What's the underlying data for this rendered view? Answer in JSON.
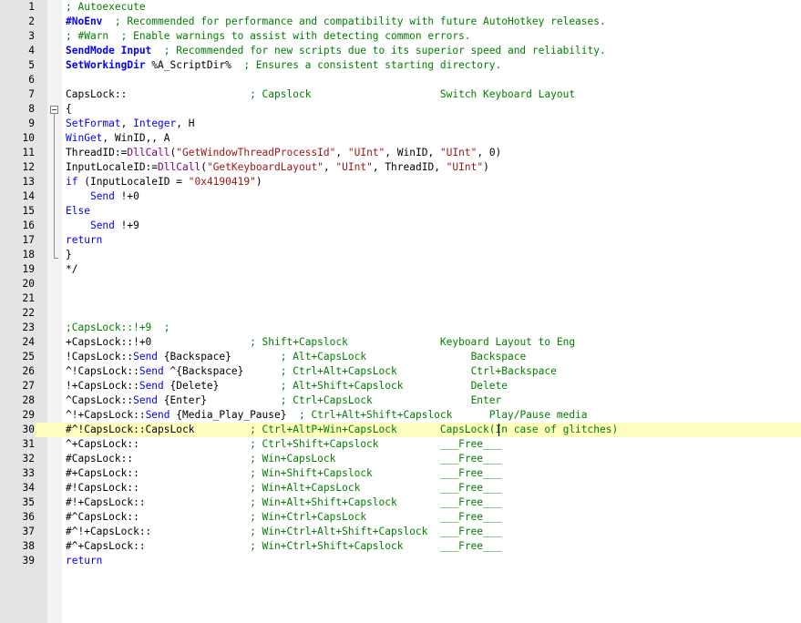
{
  "editor": {
    "current_line": 30,
    "lines": [
      {
        "n": "1",
        "tokens": [
          {
            "t": "; Autoexecute",
            "c": "comment"
          }
        ]
      },
      {
        "n": "2",
        "tokens": [
          {
            "t": "#NoEnv",
            "c": "dir"
          },
          {
            "t": "  ; Recommended for performance and compatibility with future AutoHotkey releases.",
            "c": "comment"
          }
        ]
      },
      {
        "n": "3",
        "tokens": [
          {
            "t": "; #Warn  ; Enable warnings to assist with detecting common errors.",
            "c": "comment"
          }
        ]
      },
      {
        "n": "4",
        "tokens": [
          {
            "t": "SendMode Input",
            "c": "dir"
          },
          {
            "t": "  ; Recommended for new scripts due to its superior speed and reliability.",
            "c": "comment"
          }
        ]
      },
      {
        "n": "5",
        "tokens": [
          {
            "t": "SetWorkingDir",
            "c": "dir"
          },
          {
            "t": " %A_ScriptDir%",
            "c": "plain"
          },
          {
            "t": "  ; Ensures a consistent starting directory.",
            "c": "comment"
          }
        ]
      },
      {
        "n": "6",
        "tokens": []
      },
      {
        "n": "7",
        "tokens": [
          {
            "t": "CapsLock::                    ",
            "c": "plain"
          },
          {
            "t": "; Capslock                     Switch Keyboard Layout",
            "c": "comment"
          }
        ]
      },
      {
        "n": "8",
        "tokens": [
          {
            "t": "{",
            "c": "plain"
          }
        ]
      },
      {
        "n": "9",
        "tokens": [
          {
            "t": "SetFormat",
            "c": "cmd"
          },
          {
            "t": ", ",
            "c": "plain"
          },
          {
            "t": "Integer",
            "c": "cmd"
          },
          {
            "t": ", H",
            "c": "plain"
          }
        ]
      },
      {
        "n": "10",
        "tokens": [
          {
            "t": "WinGet",
            "c": "cmd"
          },
          {
            "t": ", WinID,, A",
            "c": "plain"
          }
        ]
      },
      {
        "n": "11",
        "tokens": [
          {
            "t": "ThreadID:=",
            "c": "plain"
          },
          {
            "t": "DllCall",
            "c": "fn"
          },
          {
            "t": "(",
            "c": "plain"
          },
          {
            "t": "\"GetWindowThreadProcessId\"",
            "c": "str"
          },
          {
            "t": ", ",
            "c": "plain"
          },
          {
            "t": "\"UInt\"",
            "c": "str"
          },
          {
            "t": ", WinID, ",
            "c": "plain"
          },
          {
            "t": "\"UInt\"",
            "c": "str"
          },
          {
            "t": ", 0)",
            "c": "plain"
          }
        ]
      },
      {
        "n": "12",
        "tokens": [
          {
            "t": "InputLocaleID:=",
            "c": "plain"
          },
          {
            "t": "DllCall",
            "c": "fn"
          },
          {
            "t": "(",
            "c": "plain"
          },
          {
            "t": "\"GetKeyboardLayout\"",
            "c": "str"
          },
          {
            "t": ", ",
            "c": "plain"
          },
          {
            "t": "\"UInt\"",
            "c": "str"
          },
          {
            "t": ", ThreadID, ",
            "c": "plain"
          },
          {
            "t": "\"UInt\"",
            "c": "str"
          },
          {
            "t": ")",
            "c": "plain"
          }
        ]
      },
      {
        "n": "13",
        "tokens": [
          {
            "t": "if",
            "c": "cmd"
          },
          {
            "t": " (InputLocaleID = ",
            "c": "plain"
          },
          {
            "t": "\"0x4190419\"",
            "c": "str"
          },
          {
            "t": ")",
            "c": "plain"
          }
        ]
      },
      {
        "n": "14",
        "tokens": [
          {
            "t": "    ",
            "c": "plain"
          },
          {
            "t": "Send",
            "c": "cmd"
          },
          {
            "t": " !+0",
            "c": "plain"
          }
        ]
      },
      {
        "n": "15",
        "tokens": [
          {
            "t": "Else",
            "c": "cmd"
          }
        ]
      },
      {
        "n": "16",
        "tokens": [
          {
            "t": "    ",
            "c": "plain"
          },
          {
            "t": "Send",
            "c": "cmd"
          },
          {
            "t": " !+9",
            "c": "plain"
          }
        ]
      },
      {
        "n": "17",
        "tokens": [
          {
            "t": "return",
            "c": "cmd"
          }
        ]
      },
      {
        "n": "18",
        "tokens": [
          {
            "t": "}",
            "c": "plain"
          }
        ]
      },
      {
        "n": "19",
        "tokens": [
          {
            "t": "*/",
            "c": "plain"
          }
        ]
      },
      {
        "n": "20",
        "tokens": []
      },
      {
        "n": "21",
        "tokens": []
      },
      {
        "n": "22",
        "tokens": []
      },
      {
        "n": "23",
        "tokens": [
          {
            "t": ";CapsLock::!+9  ;",
            "c": "comment"
          }
        ]
      },
      {
        "n": "24",
        "tokens": [
          {
            "t": "+CapsLock::!+0                ",
            "c": "plain"
          },
          {
            "t": "; Shift+Capslock               Keyboard Layout to Eng",
            "c": "comment"
          }
        ]
      },
      {
        "n": "25",
        "tokens": [
          {
            "t": "!CapsLock::",
            "c": "plain"
          },
          {
            "t": "Send",
            "c": "cmd"
          },
          {
            "t": " {Backspace}        ",
            "c": "plain"
          },
          {
            "t": "; Alt+CapsLock                 Backspace",
            "c": "comment"
          }
        ]
      },
      {
        "n": "26",
        "tokens": [
          {
            "t": "^!CapsLock::",
            "c": "plain"
          },
          {
            "t": "Send",
            "c": "cmd"
          },
          {
            "t": " ^{Backspace}      ",
            "c": "plain"
          },
          {
            "t": "; Ctrl+Alt+CapsLock            Ctrl+Backspace",
            "c": "comment"
          }
        ]
      },
      {
        "n": "27",
        "tokens": [
          {
            "t": "!+CapsLock::",
            "c": "plain"
          },
          {
            "t": "Send",
            "c": "cmd"
          },
          {
            "t": " {Delete}          ",
            "c": "plain"
          },
          {
            "t": "; Alt+Shift+Capslock           Delete",
            "c": "comment"
          }
        ]
      },
      {
        "n": "28",
        "tokens": [
          {
            "t": "^CapsLock::",
            "c": "plain"
          },
          {
            "t": "Send",
            "c": "cmd"
          },
          {
            "t": " {Enter}            ",
            "c": "plain"
          },
          {
            "t": "; Ctrl+CapsLock                Enter",
            "c": "comment"
          }
        ]
      },
      {
        "n": "29",
        "tokens": [
          {
            "t": "^!+CapsLock::",
            "c": "plain"
          },
          {
            "t": "Send",
            "c": "cmd"
          },
          {
            "t": " {Media_Play_Pause}",
            "c": "plain"
          },
          {
            "t": "  ; Ctrl+Alt+Shift+Capslock      Play/Pause media",
            "c": "comment"
          }
        ]
      },
      {
        "n": "30",
        "tokens": [
          {
            "t": "#^!CapsLock::CapsLock         ",
            "c": "plain"
          },
          {
            "t": "; Ctrl+AltP+Win+CapsLock       CapsLock(In case of glitches)",
            "c": "comment"
          }
        ]
      },
      {
        "n": "31",
        "tokens": [
          {
            "t": "^+CapsLock::                  ",
            "c": "plain"
          },
          {
            "t": "; Ctrl+Shift+Capslock          ___Free___",
            "c": "comment"
          }
        ]
      },
      {
        "n": "32",
        "tokens": [
          {
            "t": "#CapsLock::                   ",
            "c": "plain"
          },
          {
            "t": "; Win+CapsLock                 ___Free___",
            "c": "comment"
          }
        ]
      },
      {
        "n": "33",
        "tokens": [
          {
            "t": "#+CapsLock::                  ",
            "c": "plain"
          },
          {
            "t": "; Win+Shift+Capslock           ___Free___",
            "c": "comment"
          }
        ]
      },
      {
        "n": "34",
        "tokens": [
          {
            "t": "#!CapsLock::                  ",
            "c": "plain"
          },
          {
            "t": "; Win+Alt+CapsLock             ___Free___",
            "c": "comment"
          }
        ]
      },
      {
        "n": "35",
        "tokens": [
          {
            "t": "#!+CapsLock::                 ",
            "c": "plain"
          },
          {
            "t": "; Win+Alt+Shift+Capslock       ___Free___",
            "c": "comment"
          }
        ]
      },
      {
        "n": "36",
        "tokens": [
          {
            "t": "#^CapsLock::                  ",
            "c": "plain"
          },
          {
            "t": "; Win+Ctrl+CapsLock            ___Free___",
            "c": "comment"
          }
        ]
      },
      {
        "n": "37",
        "tokens": [
          {
            "t": "#^!+CapsLock::                ",
            "c": "plain"
          },
          {
            "t": "; Win+Ctrl+Alt+Shift+Capslock  ___Free___",
            "c": "comment"
          }
        ]
      },
      {
        "n": "38",
        "tokens": [
          {
            "t": "#^+CapsLock::                 ",
            "c": "plain"
          },
          {
            "t": "; Win+Ctrl+Shift+Capslock      ___Free___",
            "c": "comment"
          }
        ]
      },
      {
        "n": "39",
        "tokens": [
          {
            "t": "return",
            "c": "cmd"
          }
        ]
      }
    ]
  },
  "colors": {
    "comment": "#008000",
    "keyword": "#0000ff",
    "function": "#800080",
    "string": "#a31515",
    "current_line": "#ffffc0",
    "gutter": "#e4e4e4"
  },
  "icons": {
    "fold_toggle": "fold-collapse-icon",
    "fold_guide": "fold-guide-line"
  }
}
